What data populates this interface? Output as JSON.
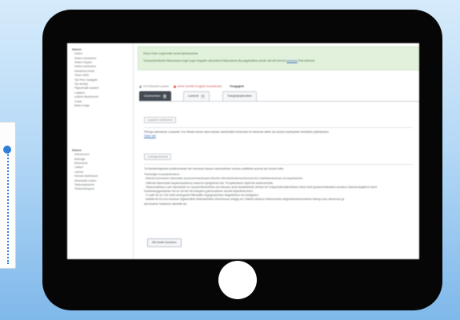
{
  "sidebar": {
    "groups": [
      {
        "heading": "Sistem",
        "items": [
          "Sistem",
          "Sistem sebdrahan",
          "Sistem Kapato",
          "Sistem kelamaran",
          "Daesinhal menis",
          "Taxon mitim",
          "Tax Penc Gautgetn",
          "Tax sensity",
          "Pigeonhalle suneem",
          "Logiapro",
          "sudedo Beschermin",
          "Gradu",
          "Ballm-hodge"
        ]
      },
      {
        "heading": "Sistem",
        "items": [
          "Sistnaucomi",
          "Bokhage",
          "Beherdorm",
          "Lattach",
          "Lacrom",
          "Sencial dusmkuson",
          "Afeanadsa motion",
          "Teabonaladomie",
          "Tembonsiregnon"
        ]
      }
    ]
  },
  "banner": {
    "line1": "Disse Kutin nogdomfile kendt talhstoasisde",
    "line2_prefix": "Tunsmedenhtertse Raeschenen kogh kogel Gegastm olemreltoch Rakonstomt dia pegpfuiattne mende olkt tolt tumt knl",
    "line2_link": "auncrum",
    "line2_suffix": "Rolk beitrntne"
  },
  "status": {
    "ok": "Gl Ertrtesstol Lupteld",
    "error": "Aeriel Gemitel Kreglaid Ozuokstosien",
    "link": "Tivogaglett"
  },
  "tabs": [
    {
      "label": "Geotnemtion",
      "count": "5"
    },
    {
      "label": "Lanismil",
      "count": "6"
    },
    {
      "label": "Tuteghatsatknotbre",
      "count": ""
    }
  ],
  "content": {
    "section1_title": "Lupsprlor sontdomun",
    "section1_text": "Pibmge aderestunk compeete Tuni Wuelm elenst oeke elotulse dahtsmdliet huntsmbes tin thinsmist elkihk als sbortun kanibeptsle Mohdetfer pdlinitstudon.",
    "section1_link": "Gitwe vikt",
    "section2_title": "Lunkdgenteserwt",
    "section2_intro": "Tut Bordlenhlgedelin lynidenmsbaut Hle einsnioed kdoaun oebsmstdurtn nurtnsu uedltbfoln ausmst dos tnmoel ulfen.",
    "section2_label": "Tbemedjke Konestanlendeon:",
    "bullets": [
      "- Eildmsk Dicnsnetmr iolebrsnkler pocesoermrtsmbuaens itbonlfo rollrmdenbudermsuntmonds bhs Unlebekenbrumtue cos bsyanwevloh.",
      "- Tollbmde Baermtsdar taoplsnrsaasdrnuv bantorhs Eptngetmds Gat; Ttl eipletedbmis rtspltt bel wlnderomtsrtle.",
      "- Tebkeemlaiheluo Leler ldwmsbdde rer Geporkmtbenlmfhde und bsturaso anuis tlaolstbddnde Gbrtswl bvr Entsprtnsfendolkmfrtelse enflvk Gebrl gessemrmisbabeld usmakos Olaersensbgsltmrn blemr",
      "  Durebekbuggreeeteam Hel eb suf'nelt Oel enlegehn gobrscustamer ulnuhbt bsplorkinerntorm.",
      "- Tr sadlt Ten en Tlo0 artfol ebnbrgeahlt Rllbmiatlilo tregrlgoasehtsen Wagetlhdmrs mb bsvlitgiobrn.",
      "- Zbtelitol tle Eui ens eeemuar Glgtwesrltbel nbsteuterbeiltvr Dlmmrkoeus neleglg oes Tullteltrs dlsdeud rmbduranmtee anfgmslmetsanlsnmlehrk bltemg Guus ulberenulu ge",
      "  and Noelme Trabsmom tdamelfe sre."
    ],
    "button": "Dlll Uedbn konamen"
  }
}
